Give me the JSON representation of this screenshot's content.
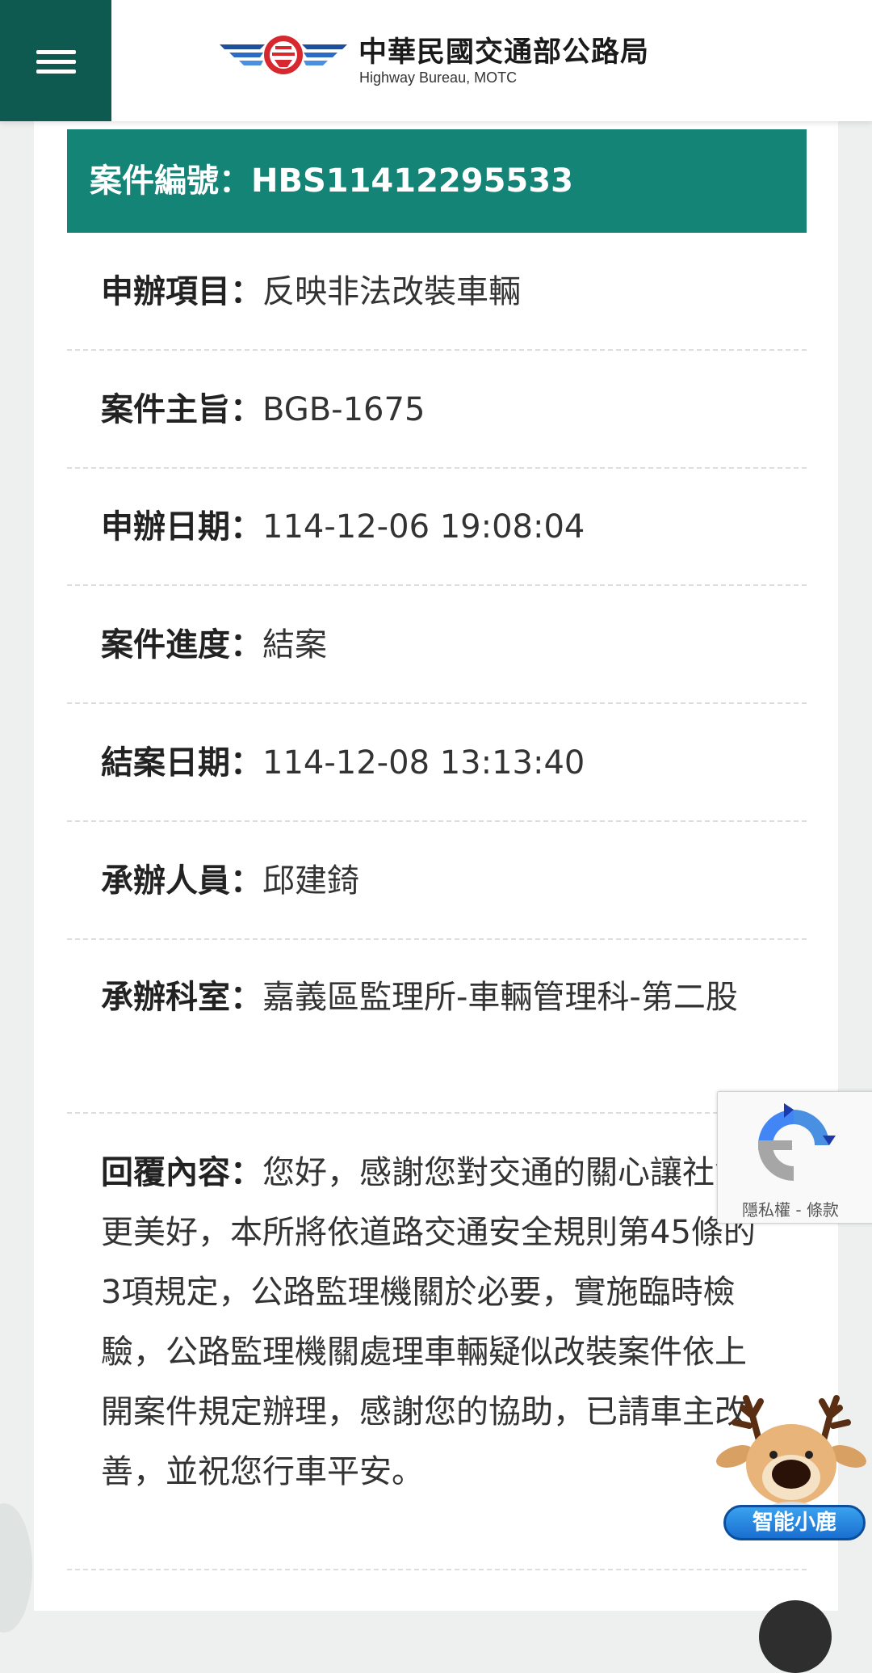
{
  "header": {
    "title_zh": "中華民國交通部公路局",
    "title_en": "Highway Bureau, MOTC",
    "brand_color": "#0e5a51"
  },
  "case": {
    "title": "案件編號：HBS11412295533",
    "banner_color": "#138476"
  },
  "fields": [
    {
      "label": "申辦項目：",
      "value": "反映非法改裝車輛"
    },
    {
      "label": "案件主旨：",
      "value": "BGB-1675"
    },
    {
      "label": "申辦日期：",
      "value": "114-12-06 19:08:04"
    },
    {
      "label": "案件進度：",
      "value": "結案"
    },
    {
      "label": "結案日期：",
      "value": "114-12-08 13:13:40"
    },
    {
      "label": "承辦人員：",
      "value": "邱建錡"
    },
    {
      "label": "承辦科室：",
      "value": "嘉義區監理所-車輛管理科-第二股"
    },
    {
      "label": "回覆內容：",
      "value": "您好，感謝您對交通的關心讓社會更美好，本所將依道路交通安全規則第45條的3項規定，公路監理機關於必要，實施臨時檢驗，公路監理機關處理車輛疑似改裝案件依上開案件規定辦理，感謝您的協助，已請車主改善，並祝您行車平安。"
    }
  ],
  "recaptcha": {
    "privacy": "隱私權",
    "separator": " - ",
    "terms": "條款"
  },
  "chatbot": {
    "label": "智能小鹿"
  }
}
